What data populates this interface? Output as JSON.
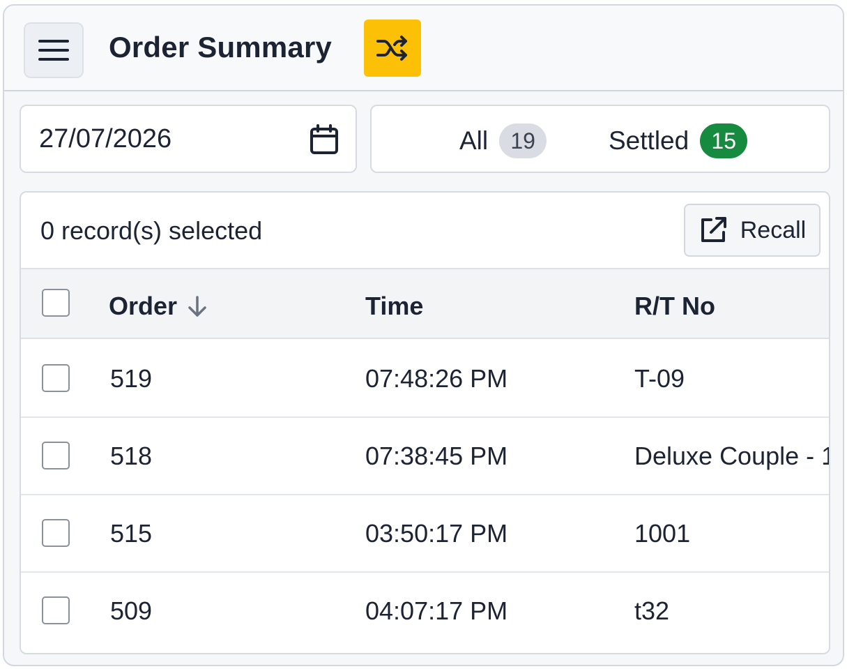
{
  "header": {
    "title": "Order Summary",
    "menu_icon": "hamburger-menu-icon",
    "shuffle_icon": "shuffle-icon",
    "accent_color": "#fcc107"
  },
  "filters": {
    "date_value": "27/07/2026",
    "calendar_icon": "calendar-icon",
    "tabs": [
      {
        "label": "All",
        "count": "19",
        "badge_color": "#d9dde3"
      },
      {
        "label": "Settled",
        "count": "15",
        "badge_color": "#168a3f"
      }
    ]
  },
  "table": {
    "selected_text": "0 record(s) selected",
    "recall_label": "Recall",
    "recall_icon": "external-link-icon",
    "columns": {
      "order": "Order",
      "time": "Time",
      "rt_no": "R/T No",
      "sort_icon": "arrow-down-icon"
    },
    "rows": [
      {
        "order": "519",
        "time": "07:48:26 PM",
        "rt_no": "T-09"
      },
      {
        "order": "518",
        "time": "07:38:45 PM",
        "rt_no": "Deluxe Couple - 1"
      },
      {
        "order": "515",
        "time": "03:50:17 PM",
        "rt_no": "1001"
      },
      {
        "order": "509",
        "time": "04:07:17 PM",
        "rt_no": "t32"
      }
    ]
  }
}
